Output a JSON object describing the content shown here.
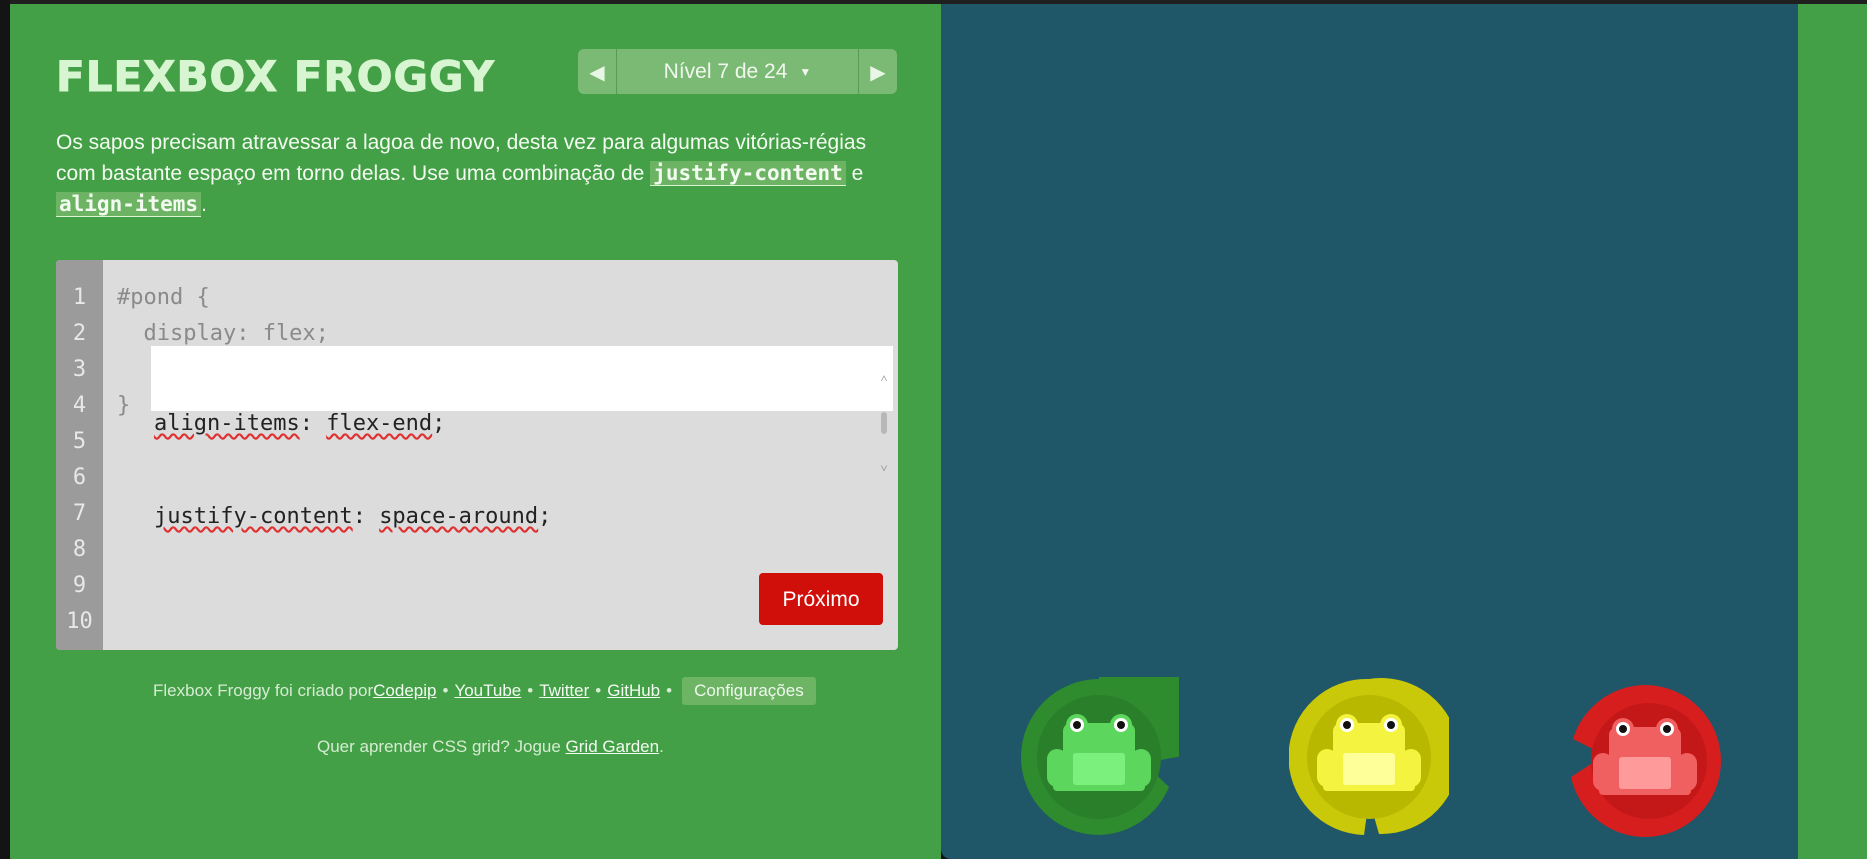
{
  "header": {
    "title": "FLEXBOX FROGGY"
  },
  "level_nav": {
    "prev_glyph": "◀",
    "next_glyph": "▶",
    "caret_glyph": "▼",
    "level_text": "Nível 7 de 24"
  },
  "instructions": {
    "part1": "Os sapos precisam atravessar a lagoa de novo, desta vez para algumas vitórias-régias com bastante espaço em torno delas. Use uma combinação de ",
    "code1": "justify-content",
    "part2": " e ",
    "code2": "align-items",
    "part3": "."
  },
  "editor": {
    "line_numbers": [
      "1",
      "2",
      "3",
      "4",
      "5",
      "6",
      "7",
      "8",
      "9",
      "10"
    ],
    "line1": "#pond {",
    "line2": "  display: flex;",
    "input_line1_prop": "align-items",
    "input_line1_colon": ": ",
    "input_line1_value": "flex-end",
    "input_line1_end": ";",
    "input_line2_prop": "justify-content",
    "input_line2_colon": ": ",
    "input_line2_value": "space-around",
    "input_line2_end": ";",
    "closing_brace": "}",
    "next_button": "Próximo"
  },
  "footer": {
    "credit_prefix": "Flexbox Froggy foi criado por ",
    "links": [
      "Codepip",
      "YouTube",
      "Twitter",
      "GitHub"
    ],
    "separator": "•",
    "settings_button": "Configurações",
    "grid_prefix": "Quer aprender CSS grid? Jogue ",
    "grid_link": "Grid Garden",
    "grid_suffix": "."
  },
  "pond": {
    "frogs": [
      {
        "color": "green",
        "pad": "#2e8b2e",
        "pad_dark": "#2a7f2a",
        "body": "#5cd65c",
        "belly": "#7cf07c"
      },
      {
        "color": "yellow",
        "pad": "#c9c90a",
        "pad_dark": "#b8b800",
        "body": "#f4f440",
        "belly": "#ffff9a"
      },
      {
        "color": "red",
        "pad": "#d61e1e",
        "pad_dark": "#c41818",
        "body": "#f06060",
        "belly": "#ff9a9a"
      }
    ]
  },
  "colors": {
    "sidebar": "#43a047",
    "pond": "#1f5768",
    "next_button": "#d10f0a"
  }
}
